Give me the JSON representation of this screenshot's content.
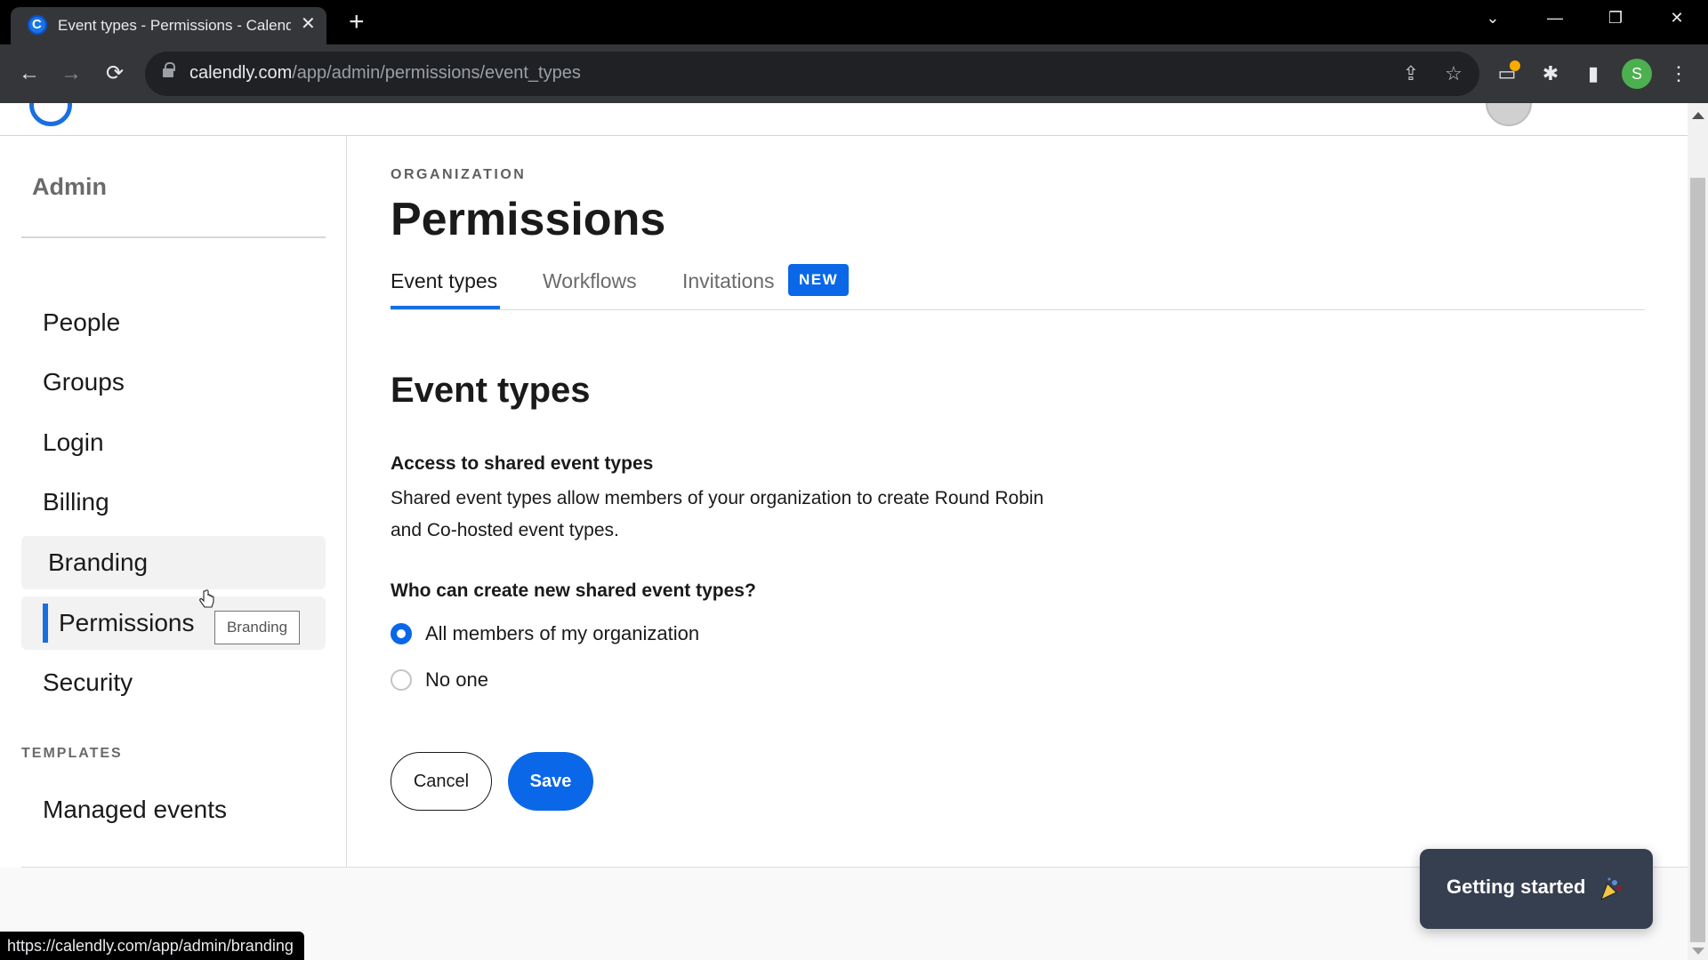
{
  "browser": {
    "tab_title": "Event types - Permissions - Calendly",
    "url_host": "calendly.com",
    "url_path": "/app/admin/permissions/event_types",
    "profile_initial": "S",
    "status_url": "https://calendly.com/app/admin/branding",
    "icons": {
      "back": "←",
      "forward": "→",
      "reload": "⟳",
      "new_tab": "+",
      "close_tab": "✕",
      "tab_search": "⌄",
      "minimize": "—",
      "restore": "❐",
      "close": "✕",
      "share": "⇪",
      "star": "☆",
      "extensions": "✱",
      "side_panel": "▮",
      "menu": "⋮",
      "notification": "▭"
    }
  },
  "sidebar": {
    "title": "Admin",
    "items": [
      {
        "label": "People",
        "state": "default"
      },
      {
        "label": "Groups",
        "state": "default"
      },
      {
        "label": "Login",
        "state": "default"
      },
      {
        "label": "Billing",
        "state": "default"
      },
      {
        "label": "Branding",
        "state": "hover"
      },
      {
        "label": "Permissions",
        "state": "active"
      },
      {
        "label": "Security",
        "state": "default"
      }
    ],
    "templates_label": "TEMPLATES",
    "template_items": [
      {
        "label": "Managed events"
      }
    ],
    "tooltip": "Branding"
  },
  "main": {
    "eyebrow": "ORGANIZATION",
    "title": "Permissions",
    "tabs": [
      {
        "label": "Event types",
        "active": true
      },
      {
        "label": "Workflows",
        "active": false
      },
      {
        "label": "Invitations",
        "active": false,
        "badge": "NEW"
      }
    ],
    "section_title": "Event types",
    "sub_heading": "Access to shared event types",
    "description": "Shared event types allow members of your organization to create Round Robin and Co-hosted event types.",
    "question": "Who can create new shared event types?",
    "options": [
      {
        "label": "All members of my organization",
        "selected": true
      },
      {
        "label": "No one",
        "selected": false
      }
    ],
    "cancel_label": "Cancel",
    "save_label": "Save"
  },
  "getting_started": {
    "label": "Getting started",
    "icon": "party-popper"
  },
  "colors": {
    "accent": "#0a67e8",
    "widget_bg": "#363f4f"
  }
}
